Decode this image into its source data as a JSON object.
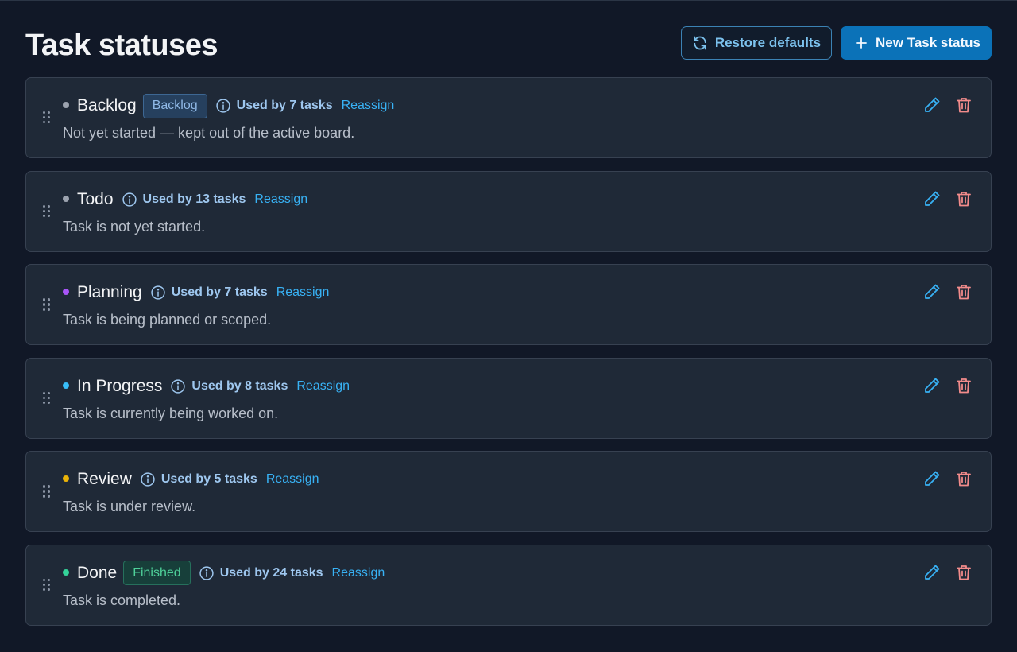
{
  "page": {
    "title": "Task statuses",
    "restore_label": "Restore defaults",
    "new_label": "New Task status"
  },
  "colors": {
    "background": "#111827",
    "card": "#1f2937",
    "accent": "#0b72b8",
    "link": "#38b2f5",
    "delete": "#f28b8b"
  },
  "icons": {
    "restore": "refresh-icon",
    "new": "plus-icon",
    "drag": "drag-handle-icon",
    "info": "info-icon",
    "edit": "pencil-icon",
    "delete": "trash-icon"
  },
  "statuses": [
    {
      "name": "Backlog",
      "color": "#9ca3af",
      "badge": "Backlog",
      "badge_style": "blue",
      "usage": "Used by 7 tasks",
      "reassign": "Reassign",
      "description": "Not yet started — kept out of the active board."
    },
    {
      "name": "Todo",
      "color": "#9ca3af",
      "badge": null,
      "badge_style": null,
      "usage": "Used by 13 tasks",
      "reassign": "Reassign",
      "description": "Task is not yet started."
    },
    {
      "name": "Planning",
      "color": "#a855f7",
      "badge": null,
      "badge_style": null,
      "usage": "Used by 7 tasks",
      "reassign": "Reassign",
      "description": "Task is being planned or scoped."
    },
    {
      "name": "In Progress",
      "color": "#38bdf8",
      "badge": null,
      "badge_style": null,
      "usage": "Used by 8 tasks",
      "reassign": "Reassign",
      "description": "Task is currently being worked on."
    },
    {
      "name": "Review",
      "color": "#eab308",
      "badge": null,
      "badge_style": null,
      "usage": "Used by 5 tasks",
      "reassign": "Reassign",
      "description": "Task is under review."
    },
    {
      "name": "Done",
      "color": "#34d399",
      "badge": "Finished",
      "badge_style": "green",
      "usage": "Used by 24 tasks",
      "reassign": "Reassign",
      "description": "Task is completed."
    }
  ]
}
